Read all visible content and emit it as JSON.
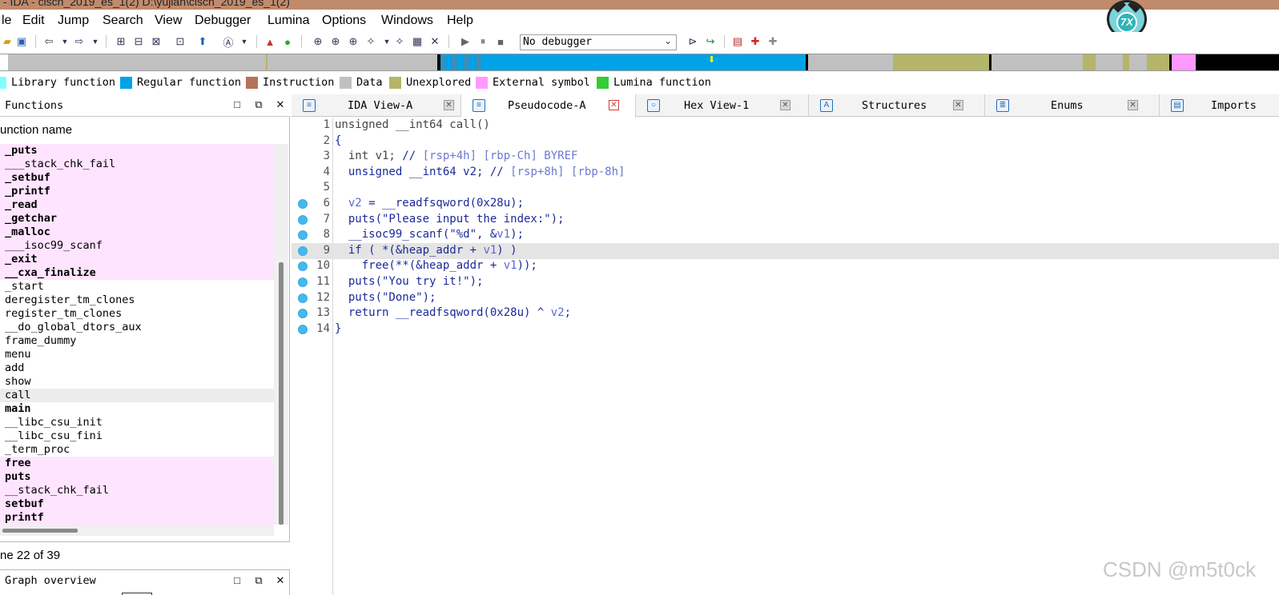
{
  "titlebar": {
    "text": "- IDA - ciscn_2019_es_1(2) D:\\yujian\\ciscn_2019_es_1(2)"
  },
  "menu": [
    "le",
    "Edit",
    "Jump",
    "Search",
    "View",
    "Debugger",
    "Lumina",
    "Options",
    "Windows",
    "Help"
  ],
  "toolbar": {
    "debugger_select": "No debugger"
  },
  "avatar": {
    "glyph": "7X"
  },
  "legend": [
    {
      "label": "Library function",
      "color": "#80ffff"
    },
    {
      "label": "Regular function",
      "color": "#00a2e8"
    },
    {
      "label": "Instruction",
      "color": "#b5735a"
    },
    {
      "label": "Data",
      "color": "#c0c0c0"
    },
    {
      "label": "Unexplored",
      "color": "#b5b56a"
    },
    {
      "label": "External symbol",
      "color": "#ff99ff"
    },
    {
      "label": "Lumina function",
      "color": "#33cc33"
    }
  ],
  "functions_panel": {
    "title": "Functions",
    "column_header": "unction name",
    "rows": [
      {
        "name": "_puts",
        "bold": true,
        "bg": "#ffe4ff"
      },
      {
        "name": "___stack_chk_fail",
        "bold": false,
        "bg": "#ffe4ff"
      },
      {
        "name": "_setbuf",
        "bold": true,
        "bg": "#ffe4ff"
      },
      {
        "name": "_printf",
        "bold": true,
        "bg": "#ffe4ff"
      },
      {
        "name": "_read",
        "bold": true,
        "bg": "#ffe4ff"
      },
      {
        "name": "_getchar",
        "bold": true,
        "bg": "#ffe4ff"
      },
      {
        "name": "_malloc",
        "bold": true,
        "bg": "#ffe4ff"
      },
      {
        "name": "___isoc99_scanf",
        "bold": false,
        "bg": "#ffe4ff"
      },
      {
        "name": "_exit",
        "bold": true,
        "bg": "#ffe4ff"
      },
      {
        "name": "__cxa_finalize",
        "bold": true,
        "bg": "#ffe4ff"
      },
      {
        "name": "_start",
        "bold": false,
        "bg": "#ffffff"
      },
      {
        "name": "deregister_tm_clones",
        "bold": false,
        "bg": "#ffffff"
      },
      {
        "name": "register_tm_clones",
        "bold": false,
        "bg": "#ffffff"
      },
      {
        "name": "__do_global_dtors_aux",
        "bold": false,
        "bg": "#ffffff"
      },
      {
        "name": "frame_dummy",
        "bold": false,
        "bg": "#ffffff"
      },
      {
        "name": "menu",
        "bold": false,
        "bg": "#ffffff"
      },
      {
        "name": "add",
        "bold": false,
        "bg": "#ffffff"
      },
      {
        "name": "show",
        "bold": false,
        "bg": "#ffffff"
      },
      {
        "name": "call",
        "bold": false,
        "bg": "#ececec"
      },
      {
        "name": "main",
        "bold": true,
        "bg": "#ffffff"
      },
      {
        "name": "__libc_csu_init",
        "bold": false,
        "bg": "#ffffff"
      },
      {
        "name": "__libc_csu_fini",
        "bold": false,
        "bg": "#ffffff"
      },
      {
        "name": "_term_proc",
        "bold": false,
        "bg": "#ffffff"
      },
      {
        "name": "free",
        "bold": true,
        "bg": "#ffe4ff"
      },
      {
        "name": "puts",
        "bold": true,
        "bg": "#ffe4ff"
      },
      {
        "name": "__stack_chk_fail",
        "bold": false,
        "bg": "#ffe4ff"
      },
      {
        "name": "setbuf",
        "bold": true,
        "bg": "#ffe4ff"
      },
      {
        "name": "printf",
        "bold": true,
        "bg": "#ffe4ff"
      }
    ],
    "status": "ne 22 of 39"
  },
  "graph_overview": {
    "title": "Graph overview"
  },
  "tabs": [
    {
      "label": "IDA View-A",
      "icon": "ida-view-icon",
      "active": false
    },
    {
      "label": "Pseudocode-A",
      "icon": "pseudocode-icon",
      "active": true
    },
    {
      "label": "Hex View-1",
      "icon": "hex-view-icon",
      "active": false
    },
    {
      "label": "Structures",
      "icon": "structures-icon",
      "active": false
    },
    {
      "label": "Enums",
      "icon": "enums-icon",
      "active": false
    },
    {
      "label": "Imports",
      "icon": "imports-icon",
      "active": false
    }
  ],
  "code": [
    {
      "n": "1",
      "dot": false,
      "hl": false,
      "parts": [
        [
          "gr",
          "unsigned __int64 call()"
        ]
      ]
    },
    {
      "n": "2",
      "dot": false,
      "hl": false,
      "parts": [
        [
          "pl",
          "{"
        ]
      ]
    },
    {
      "n": "3",
      "dot": false,
      "hl": false,
      "parts": [
        [
          "gr",
          "  int v1; "
        ],
        [
          "pl",
          "// "
        ],
        [
          "cm",
          "[rsp+4h] [rbp-Ch] BYREF"
        ]
      ]
    },
    {
      "n": "4",
      "dot": false,
      "hl": false,
      "parts": [
        [
          "pl",
          "  unsigned __int64 v2; "
        ],
        [
          "pl",
          "// "
        ],
        [
          "cm",
          "[rsp+8h] [rbp-8h]"
        ]
      ]
    },
    {
      "n": "5",
      "dot": false,
      "hl": false,
      "parts": [
        [
          "pl",
          ""
        ]
      ]
    },
    {
      "n": "6",
      "dot": true,
      "hl": false,
      "parts": [
        [
          "pl",
          "  "
        ],
        [
          "var",
          "v2"
        ],
        [
          "pl",
          " = __readfsqword(0x28u);"
        ]
      ]
    },
    {
      "n": "7",
      "dot": true,
      "hl": false,
      "parts": [
        [
          "pl",
          "  puts(\"Please input the index:\");"
        ]
      ]
    },
    {
      "n": "8",
      "dot": true,
      "hl": false,
      "parts": [
        [
          "pl",
          "  __isoc99_scanf(\"%d\", &"
        ],
        [
          "var",
          "v1"
        ],
        [
          "pl",
          ");"
        ]
      ]
    },
    {
      "n": "9",
      "dot": true,
      "hl": true,
      "parts": [
        [
          "pl",
          "  if ( *(&heap_addr + "
        ],
        [
          "var",
          "v1"
        ],
        [
          "pl",
          ") )"
        ]
      ]
    },
    {
      "n": "10",
      "dot": true,
      "hl": false,
      "parts": [
        [
          "pl",
          "    free(**(&heap_addr + "
        ],
        [
          "var",
          "v1"
        ],
        [
          "pl",
          "));"
        ]
      ]
    },
    {
      "n": "11",
      "dot": true,
      "hl": false,
      "parts": [
        [
          "pl",
          "  puts(\"You try it!\");"
        ]
      ]
    },
    {
      "n": "12",
      "dot": true,
      "hl": false,
      "parts": [
        [
          "pl",
          "  puts(\"Done\");"
        ]
      ]
    },
    {
      "n": "13",
      "dot": true,
      "hl": false,
      "parts": [
        [
          "pl",
          "  return __readfsqword(0x28u) ^ "
        ],
        [
          "var",
          "v2"
        ],
        [
          "pl",
          ";"
        ]
      ]
    },
    {
      "n": "14",
      "dot": true,
      "hl": false,
      "parts": [
        [
          "pl",
          "}"
        ]
      ]
    }
  ],
  "navband_colors": {
    "regular": "#00a2e8",
    "unexplored": "#b5b56a",
    "data": "#c0c0c0",
    "external": "#ff99ff",
    "black": "#000000"
  },
  "watermark": "CSDN @m5t0ck"
}
